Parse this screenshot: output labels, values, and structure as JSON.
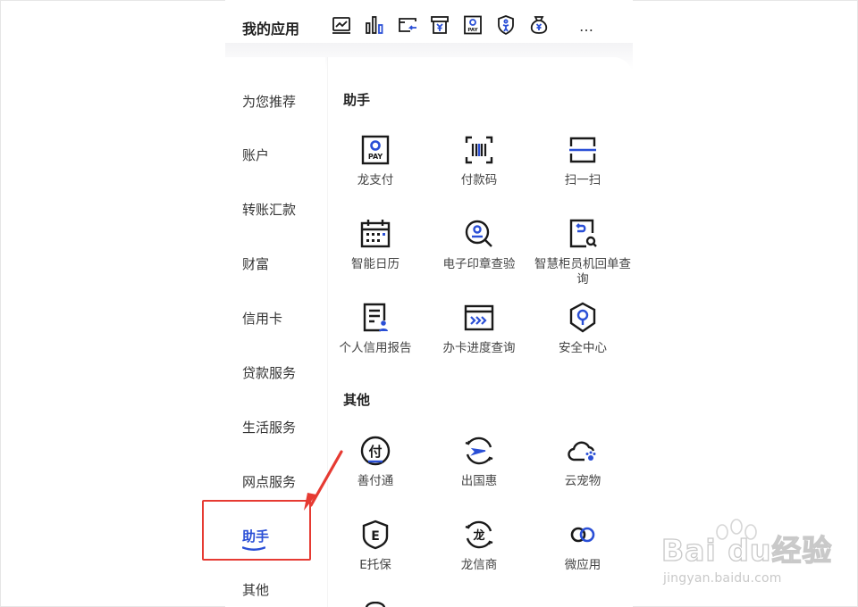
{
  "header": {
    "title": "我的应用",
    "more": "…",
    "quick_icons": [
      "chart-card-icon",
      "bar-chart-icon",
      "card-arrow-icon",
      "yuan-box-icon",
      "pay-icon",
      "shield-person-icon",
      "money-bag-icon"
    ]
  },
  "sidebar": {
    "items": [
      {
        "label": "为您推荐"
      },
      {
        "label": "账户"
      },
      {
        "label": "转账汇款"
      },
      {
        "label": "财富"
      },
      {
        "label": "信用卡"
      },
      {
        "label": "贷款服务"
      },
      {
        "label": "生活服务"
      },
      {
        "label": "网点服务"
      },
      {
        "label": "助手",
        "active": true
      },
      {
        "label": "其他"
      }
    ]
  },
  "sections": [
    {
      "title": "助手",
      "tiles": [
        {
          "label": "龙支付",
          "icon": "long-pay-icon"
        },
        {
          "label": "付款码",
          "icon": "payment-code-icon"
        },
        {
          "label": "扫一扫",
          "icon": "scan-icon"
        },
        {
          "label": "智能日历",
          "icon": "calendar-icon"
        },
        {
          "label": "电子印章查验",
          "icon": "seal-search-icon"
        },
        {
          "label": "智慧柜员机回单查询",
          "icon": "receipt-search-icon"
        },
        {
          "label": "个人信用报告",
          "icon": "credit-report-icon"
        },
        {
          "label": "办卡进度查询",
          "icon": "card-progress-icon"
        },
        {
          "label": "安全中心",
          "icon": "security-shield-icon"
        }
      ]
    },
    {
      "title": "其他",
      "tiles": [
        {
          "label": "善付通",
          "icon": "fu-circle-icon"
        },
        {
          "label": "出国惠",
          "icon": "plane-circle-icon"
        },
        {
          "label": "云宠物",
          "icon": "cloud-pet-icon"
        },
        {
          "label": "E托保",
          "icon": "e-shield-icon"
        },
        {
          "label": "龙信商",
          "icon": "long-circle-icon"
        },
        {
          "label": "微应用",
          "icon": "link-rings-icon"
        }
      ]
    }
  ],
  "colors": {
    "accent": "#2a4fd6",
    "highlight": "#e63a32",
    "icon_dark": "#1a1a1a"
  },
  "watermark": {
    "brand": "Bai du经验",
    "url": "jingyan.baidu.com"
  }
}
